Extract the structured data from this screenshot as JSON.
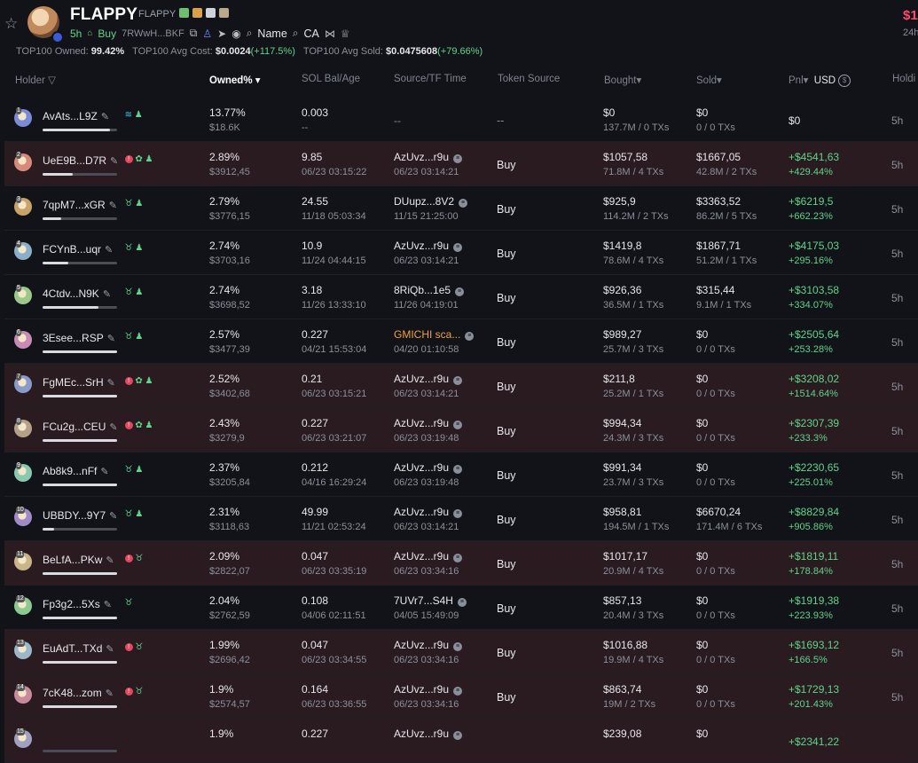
{
  "header": {
    "token_name": "FLAPPY",
    "token_symbol": "FLAPPY",
    "age": "5h",
    "buy_label": "Buy",
    "address": "7RWwH...BKF",
    "name_search_label": "Name",
    "ca_search_label": "CA",
    "price_partial": "$1",
    "price_sub_partial": "24h"
  },
  "summary": {
    "owned_label": "TOP100 Owned:",
    "owned_value": "99.42%",
    "avg_cost_label": "TOP100 Avg Cost:",
    "avg_cost_value": "$0.0024",
    "avg_cost_change": "(+117.5%)",
    "avg_sold_label": "TOP100 Avg Sold:",
    "avg_sold_value": "$0.0475608",
    "avg_sold_change": "(+79.66%)"
  },
  "columns": {
    "holder": "Holder",
    "owned": "Owned%",
    "sol": "SOL Bal/Age",
    "source": "Source/TF Time",
    "token_source": "Token Source",
    "bought": "Bought",
    "sold": "Sold",
    "pnl": "Pnl",
    "currency": "USD",
    "holding": "Holdi"
  },
  "colors": {
    "bg": "#121318",
    "pink_row": "#2a1b21",
    "green": "#5fd48a",
    "red": "#ff4b6e",
    "orange": "#f0a040"
  },
  "rows": [
    {
      "rank": "1",
      "name": "AvAts...L9Z",
      "icons": "fish,user",
      "pink": false,
      "bar": 0.9,
      "owned": "13.77%",
      "owned_usd": "$18.6K",
      "sol": "0.003",
      "sol_age": "--",
      "src": "--",
      "src_time": "",
      "src_orange": false,
      "token_source": "--",
      "bought": "$0",
      "bought_sub": "137.7M / 0 TXs",
      "sold": "$0",
      "sold_sub": "0 / 0 TXs",
      "pnl": "$0",
      "pnl_pct": "",
      "hold": "5h"
    },
    {
      "rank": "2",
      "name": "UeE9B...D7R",
      "icons": "red,leaf,user",
      "pink": true,
      "bar": 0.4,
      "owned": "2.89%",
      "owned_usd": "$3912,45",
      "sol": "9.85",
      "sol_age": "06/23 03:15:22",
      "src": "AzUvz...r9u",
      "src_time": "06/23 03:14:21",
      "src_orange": false,
      "token_source": "Buy",
      "bought": "$1057,58",
      "bought_sub": "71.8M / 4 TXs",
      "sold": "$1667,05",
      "sold_sub": "42.8M / 2 TXs",
      "pnl": "+$4541,63",
      "pnl_pct": "+429.44%",
      "hold": "5h"
    },
    {
      "rank": "3",
      "name": "7qpM7...xGR",
      "icons": "bull,user",
      "pink": false,
      "bar": 0.25,
      "owned": "2.79%",
      "owned_usd": "$3776,15",
      "sol": "24.55",
      "sol_age": "11/18 05:03:34",
      "src": "DUupz...8V2",
      "src_time": "11/15 21:25:00",
      "src_orange": false,
      "token_source": "Buy",
      "bought": "$925,9",
      "bought_sub": "114.2M / 2 TXs",
      "sold": "$3363,52",
      "sold_sub": "86.2M / 5 TXs",
      "pnl": "+$6219,5",
      "pnl_pct": "+662.23%",
      "hold": "5h"
    },
    {
      "rank": "4",
      "name": "FCYnB...uqr",
      "icons": "bull,user",
      "pink": false,
      "bar": 0.35,
      "owned": "2.74%",
      "owned_usd": "$3703,16",
      "sol": "10.9",
      "sol_age": "11/24 04:44:15",
      "src": "AzUvz...r9u",
      "src_time": "06/23 03:14:21",
      "src_orange": false,
      "token_source": "Buy",
      "bought": "$1419,8",
      "bought_sub": "78.6M / 4 TXs",
      "sold": "$1867,71",
      "sold_sub": "51.2M / 1 TXs",
      "pnl": "+$4175,03",
      "pnl_pct": "+295.16%",
      "hold": "5h"
    },
    {
      "rank": "5",
      "name": "4Ctdv...N9K",
      "icons": "bull,user",
      "pink": false,
      "bar": 0.75,
      "owned": "2.74%",
      "owned_usd": "$3698,52",
      "sol": "3.18",
      "sol_age": "11/26 13:33:10",
      "src": "8RiQb...1e5",
      "src_time": "11/26 04:19:01",
      "src_orange": false,
      "token_source": "Buy",
      "bought": "$926,36",
      "bought_sub": "36.5M / 1 TXs",
      "sold": "$315,44",
      "sold_sub": "9.1M / 1 TXs",
      "pnl": "+$3103,58",
      "pnl_pct": "+334.07%",
      "hold": "5h"
    },
    {
      "rank": "6",
      "name": "3Esee...RSP",
      "icons": "bull,user",
      "pink": false,
      "bar": 1.0,
      "owned": "2.57%",
      "owned_usd": "$3477,39",
      "sol": "0.227",
      "sol_age": "04/21 15:53:04",
      "src": "GMICHI sca...",
      "src_time": "04/20 01:10:58",
      "src_orange": true,
      "token_source": "Buy",
      "bought": "$989,27",
      "bought_sub": "25.7M / 3 TXs",
      "sold": "$0",
      "sold_sub": "0 / 0 TXs",
      "pnl": "+$2505,64",
      "pnl_pct": "+253.28%",
      "hold": "5h"
    },
    {
      "rank": "7",
      "name": "FgMEc...SrH",
      "icons": "red,leaf,user",
      "pink": true,
      "bar": 1.0,
      "owned": "2.52%",
      "owned_usd": "$3402,68",
      "sol": "0.21",
      "sol_age": "06/23 03:15:21",
      "src": "AzUvz...r9u",
      "src_time": "06/23 03:14:21",
      "src_orange": false,
      "token_source": "Buy",
      "bought": "$211,8",
      "bought_sub": "25.2M / 1 TXs",
      "sold": "$0",
      "sold_sub": "0 / 0 TXs",
      "pnl": "+$3208,02",
      "pnl_pct": "+1514.64%",
      "hold": "5h"
    },
    {
      "rank": "8",
      "name": "FCu2g...CEU",
      "icons": "red,leaf,user",
      "pink": true,
      "bar": 1.0,
      "owned": "2.43%",
      "owned_usd": "$3279,9",
      "sol": "0.227",
      "sol_age": "06/23 03:21:07",
      "src": "AzUvz...r9u",
      "src_time": "06/23 03:19:48",
      "src_orange": false,
      "token_source": "Buy",
      "bought": "$994,34",
      "bought_sub": "24.3M / 3 TXs",
      "sold": "$0",
      "sold_sub": "0 / 0 TXs",
      "pnl": "+$2307,39",
      "pnl_pct": "+233.3%",
      "hold": "5h"
    },
    {
      "rank": "9",
      "name": "Ab8k9...nFf",
      "icons": "bull,user",
      "pink": false,
      "bar": 1.0,
      "owned": "2.37%",
      "owned_usd": "$3205,84",
      "sol": "0.212",
      "sol_age": "04/16 16:29:24",
      "src": "AzUvz...r9u",
      "src_time": "06/23 03:19:48",
      "src_orange": false,
      "token_source": "Buy",
      "bought": "$991,34",
      "bought_sub": "23.7M / 3 TXs",
      "sold": "$0",
      "sold_sub": "0 / 0 TXs",
      "pnl": "+$2230,65",
      "pnl_pct": "+225.01%",
      "hold": "5h"
    },
    {
      "rank": "10",
      "name": "UBBDY...9Y7",
      "icons": "bull,user",
      "pink": false,
      "bar": 0.15,
      "owned": "2.31%",
      "owned_usd": "$3118,63",
      "sol": "49.99",
      "sol_age": "11/21 02:53:24",
      "src": "AzUvz...r9u",
      "src_time": "06/23 03:14:21",
      "src_orange": false,
      "token_source": "Buy",
      "bought": "$958,81",
      "bought_sub": "194.5M / 1 TXs",
      "sold": "$6670,24",
      "sold_sub": "171.4M / 6 TXs",
      "pnl": "+$8829,84",
      "pnl_pct": "+905.86%",
      "hold": "5h"
    },
    {
      "rank": "11",
      "name": "BeLfA...PKw",
      "icons": "red,bull",
      "pink": true,
      "bar": 1.0,
      "owned": "2.09%",
      "owned_usd": "$2822,07",
      "sol": "0.047",
      "sol_age": "06/23 03:35:19",
      "src": "AzUvz...r9u",
      "src_time": "06/23 03:34:16",
      "src_orange": false,
      "token_source": "Buy",
      "bought": "$1017,17",
      "bought_sub": "20.9M / 4 TXs",
      "sold": "$0",
      "sold_sub": "0 / 0 TXs",
      "pnl": "+$1819,11",
      "pnl_pct": "+178.84%",
      "hold": "5h"
    },
    {
      "rank": "12",
      "name": "Fp3g2...5Xs",
      "icons": "bull",
      "pink": false,
      "bar": 1.0,
      "owned": "2.04%",
      "owned_usd": "$2762,59",
      "sol": "0.108",
      "sol_age": "04/06 02:11:51",
      "src": "7UVr7...S4H",
      "src_time": "04/05 15:49:09",
      "src_orange": false,
      "token_source": "Buy",
      "bought": "$857,13",
      "bought_sub": "20.4M / 3 TXs",
      "sold": "$0",
      "sold_sub": "0 / 0 TXs",
      "pnl": "+$1919,38",
      "pnl_pct": "+223.93%",
      "hold": "5h"
    },
    {
      "rank": "13",
      "name": "EuAdT...TXd",
      "icons": "red,bull",
      "pink": true,
      "bar": 1.0,
      "owned": "1.99%",
      "owned_usd": "$2696,42",
      "sol": "0.047",
      "sol_age": "06/23 03:34:55",
      "src": "AzUvz...r9u",
      "src_time": "06/23 03:34:16",
      "src_orange": false,
      "token_source": "Buy",
      "bought": "$1016,88",
      "bought_sub": "19.9M / 4 TXs",
      "sold": "$0",
      "sold_sub": "0 / 0 TXs",
      "pnl": "+$1693,12",
      "pnl_pct": "+166.5%",
      "hold": "5h"
    },
    {
      "rank": "14",
      "name": "7cK48...zom",
      "icons": "red,bull",
      "pink": true,
      "bar": 1.0,
      "owned": "1.9%",
      "owned_usd": "$2574,57",
      "sol": "0.164",
      "sol_age": "06/23 03:36:55",
      "src": "AzUvz...r9u",
      "src_time": "06/23 03:34:16",
      "src_orange": false,
      "token_source": "Buy",
      "bought": "$863,74",
      "bought_sub": "19M / 2 TXs",
      "sold": "$0",
      "sold_sub": "0 / 0 TXs",
      "pnl": "+$1729,13",
      "pnl_pct": "+201.43%",
      "hold": "5h"
    },
    {
      "rank": "15",
      "name": "",
      "icons": "",
      "pink": true,
      "bar": 0,
      "owned": "1.9%",
      "owned_usd": "",
      "sol": "0.227",
      "sol_age": "",
      "src": "AzUvz...r9u",
      "src_time": "",
      "src_orange": false,
      "token_source": "",
      "bought": "$239,08",
      "bought_sub": "",
      "sold": "$0",
      "sold_sub": "",
      "pnl": "+$2341,22",
      "pnl_pct": "",
      "hold": ""
    }
  ]
}
